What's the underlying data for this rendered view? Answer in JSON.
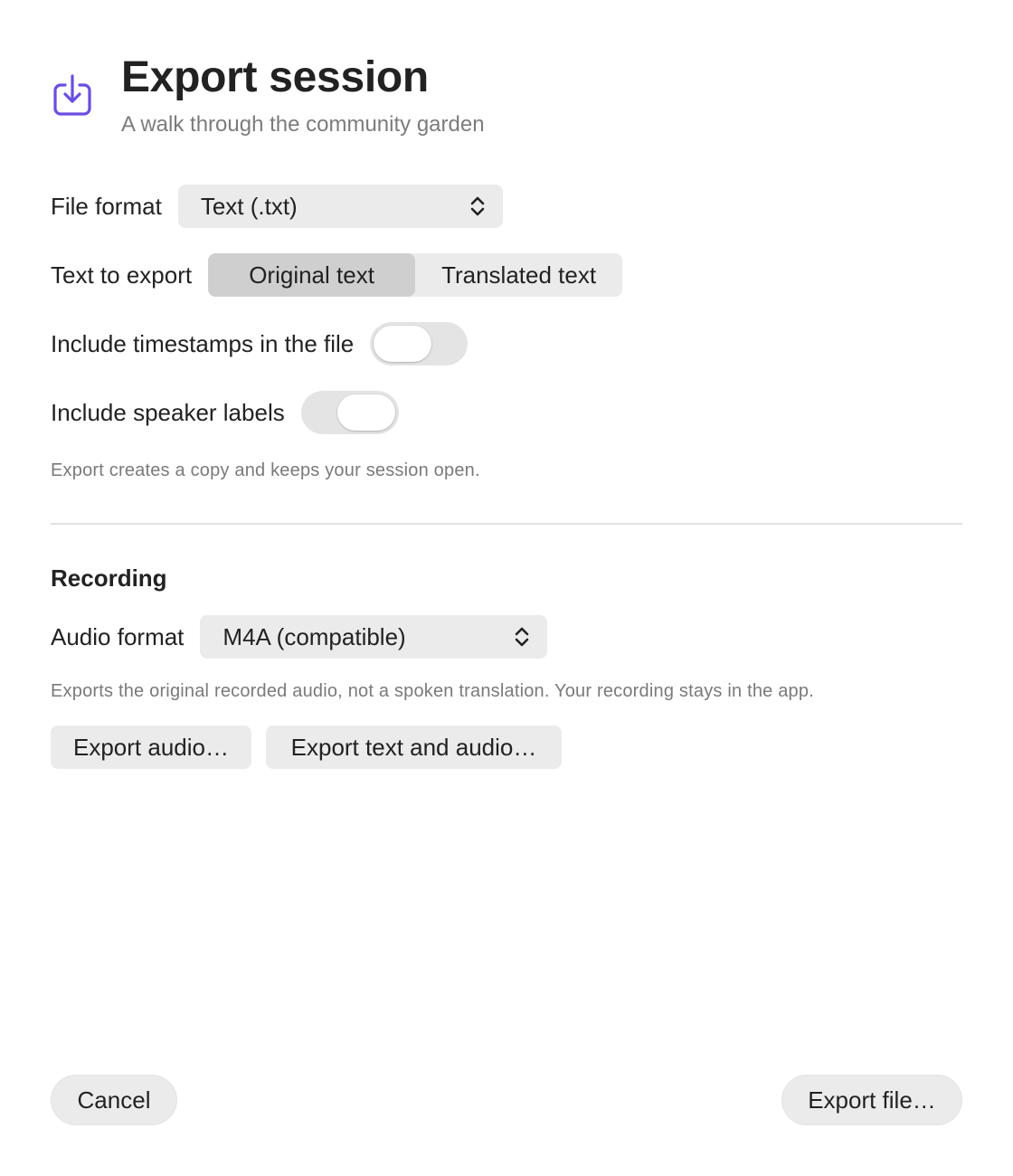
{
  "header": {
    "icon": "download-tray-icon",
    "title": "Export session",
    "subtitle": "A walk through the community garden"
  },
  "file_format": {
    "label": "File format",
    "value": "Text (.txt)"
  },
  "text_to_export": {
    "label": "Text to export",
    "options": [
      "Original text",
      "Translated text"
    ],
    "selected": "Original text"
  },
  "timestamps": {
    "label": "Include timestamps in the file",
    "enabled": false
  },
  "speaker_labels": {
    "label": "Include speaker labels"
  },
  "text_hint": "Export creates a copy and keeps your session open.",
  "recording": {
    "section_title": "Recording",
    "audio_format_label": "Audio format",
    "audio_format_value": "M4A (compatible)",
    "hint": "Exports the original recorded audio, not a spoken translation. Your recording stays in the app.",
    "export_audio_label": "Export audio…",
    "export_text_audio_label": "Export text and audio…"
  },
  "footer": {
    "cancel_label": "Cancel",
    "export_file_label": "Export file…"
  },
  "colors": {
    "accent": "#6a4ee0",
    "control_bg": "#ebebeb",
    "segment_selected": "#cfcfcf",
    "secondary_text": "#7a7a7a"
  }
}
